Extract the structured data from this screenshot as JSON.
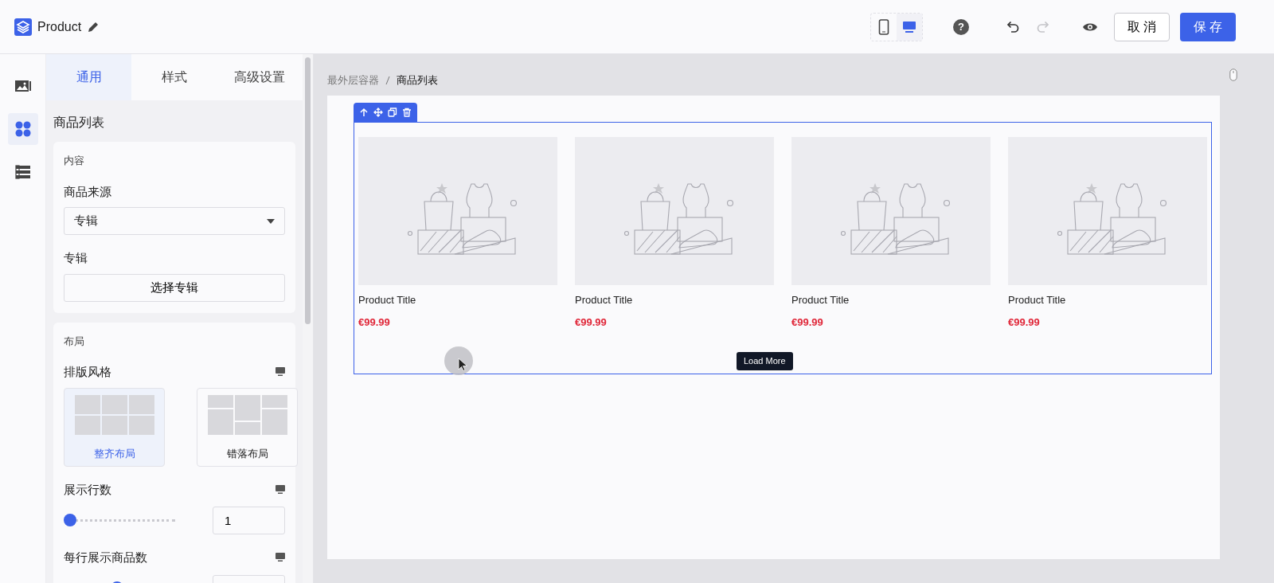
{
  "header": {
    "title": "Product",
    "devices": [
      {
        "kind": "mobile",
        "selected": false
      },
      {
        "kind": "desktop",
        "selected": true
      }
    ],
    "undo": {
      "disabled": false
    },
    "redo": {
      "disabled": true
    },
    "help_button": "?",
    "cancel_button": "取 消",
    "save_button": "保 存"
  },
  "rail": [
    {
      "kind": "images",
      "selected": false
    },
    {
      "kind": "components",
      "selected": true
    },
    {
      "kind": "layers",
      "selected": false
    }
  ],
  "tabs": [
    {
      "label": "通用",
      "selected": true
    },
    {
      "label": "样式",
      "selected": false
    },
    {
      "label": "高级设置",
      "selected": false
    }
  ],
  "section_title": "商品列表",
  "content_card": {
    "title": "内容",
    "source_label": "商品来源",
    "source_value": "专辑",
    "album_label": "专辑",
    "album_button": "选择专辑"
  },
  "layout_card": {
    "title": "布局",
    "style_label": "排版风格",
    "options": [
      {
        "label": "整齐布局",
        "kind": "grid",
        "selected": true
      },
      {
        "label": "错落布局",
        "kind": "masonry",
        "selected": false
      }
    ],
    "sliders": [
      {
        "label": "展示行数",
        "level": 0,
        "value": "1"
      },
      {
        "label": "每行展示商品数",
        "level": 0.45
      }
    ]
  },
  "canvas": {
    "breadcrumb": [
      {
        "label": "最外层容器",
        "current": false
      },
      {
        "label": "商品列表",
        "current": true
      }
    ],
    "products": [
      {
        "title": "Product Title",
        "price": "€99.99"
      },
      {
        "title": "Product Title",
        "price": "€99.99"
      },
      {
        "title": "Product Title",
        "price": "€99.99"
      },
      {
        "title": "Product Title",
        "price": "€99.99"
      }
    ],
    "load_more": "Load More"
  }
}
